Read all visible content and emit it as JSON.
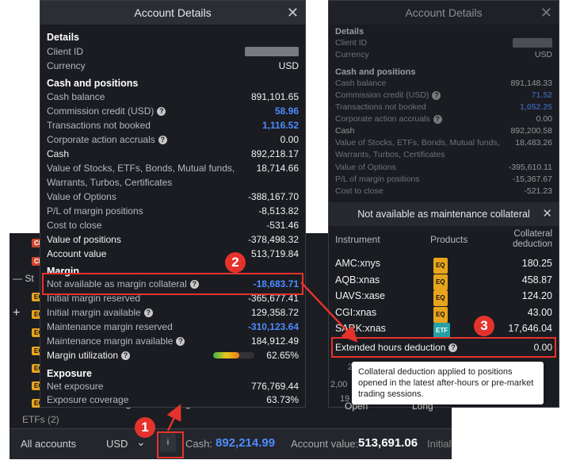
{
  "background": {
    "tickers": [
      "CF",
      "CF",
      "St",
      "EQ",
      "EQ",
      "EQ",
      "EQ",
      "EQ",
      "EQ",
      "EQ"
    ],
    "etfs_label": "ETFs (2)",
    "partial_text": "egation holdings incl",
    "bottom": {
      "accounts": "All accounts",
      "currency": "USD",
      "info_btn": "i",
      "cash_label": "Cash:",
      "cash_value": "892,214.99",
      "account_value_label": "Account value:",
      "account_value": "513,691.06",
      "initial": "Initial"
    }
  },
  "left_panel": {
    "title": "Account Details",
    "details": {
      "header": "Details",
      "client_id": "Client ID",
      "currency_label": "Currency",
      "currency_value": "USD"
    },
    "cash_positions": {
      "header": "Cash and positions",
      "cash_balance": [
        "Cash balance",
        "891,101.65"
      ],
      "commission_credit": [
        "Commission credit (USD)",
        "58.96"
      ],
      "transactions_not_booked": [
        "Transactions not booked",
        "1,116.52"
      ],
      "corporate_action": [
        "Corporate action accruals",
        "0.00"
      ],
      "cash": [
        "Cash",
        "892,218.17"
      ],
      "value_stocks_1": "Value of Stocks, ETFs, Bonds, Mutual funds,",
      "value_stocks_2": "Warrants, Turbos, Certificates",
      "value_stocks_v": "18,714.66",
      "value_options": [
        "Value of Options",
        "-388,167.70"
      ],
      "pl_margin": [
        "P/L of margin positions",
        "-8,513.82"
      ],
      "cost_close": [
        "Cost to close",
        "-531.46"
      ],
      "value_positions": [
        "Value of positions",
        "-378,498.32"
      ],
      "account_value": [
        "Account value",
        "513,719.84"
      ]
    },
    "margin": {
      "header": "Margin",
      "not_available": [
        "Not available as margin collateral",
        "-18,683.71"
      ],
      "initial_reserved": [
        "Initial margin reserved",
        "-365,677.41"
      ],
      "initial_available": [
        "Initial margin available",
        "129,358.72"
      ],
      "maint_reserved": [
        "Maintenance margin reserved",
        "-310,123.64"
      ],
      "maint_available": [
        "Maintenance margin available",
        "184,912.49"
      ],
      "utilization": [
        "Margin utilization",
        "62.65%"
      ],
      "utilization_fraction": 0.6265
    },
    "exposure": {
      "header": "Exposure",
      "net": [
        "Net exposure",
        "776,769.44"
      ],
      "coverage": [
        "Exposure coverage",
        "63.73%"
      ]
    }
  },
  "right_panel": {
    "title": "Account Details",
    "details": {
      "header": "Details",
      "client_id": "Client ID",
      "currency_label": "Currency",
      "currency_value": "USD"
    },
    "cash_positions": {
      "header": "Cash and positions",
      "cash_balance": [
        "Cash balance",
        "891,148.33"
      ],
      "commission_credit": [
        "Commission credit (USD)",
        "71.52"
      ],
      "transactions_not_booked": [
        "Transactions not booked",
        "1,052.25"
      ],
      "corporate_action": [
        "Corporate action accruals",
        "0.00"
      ],
      "cash": [
        "Cash",
        "892,200.58"
      ],
      "value_stocks_1": "Value of Stocks, ETFs, Bonds, Mutual funds,",
      "value_stocks_2": "Warrants, Turbos, Certificates",
      "value_stocks_v": "18,483.26",
      "value_options": [
        "Value of Options",
        "-395,610.11"
      ],
      "pl_margin": [
        "P/L of margin positions",
        "-15,367.67"
      ],
      "cost_close": [
        "Cost to close",
        "-521.23"
      ]
    },
    "subpanel": {
      "title": "Not available as maintenance collateral",
      "col_instrument": "Instrument",
      "col_products": "Products",
      "col_deduction_1": "Collateral",
      "col_deduction_2": "deduction",
      "rows": [
        {
          "instrument": "AMC:xnys",
          "product": "EQ",
          "value": "180.25"
        },
        {
          "instrument": "AQB:xnas",
          "product": "EQ",
          "value": "458.87"
        },
        {
          "instrument": "UAVS:xase",
          "product": "EQ",
          "value": "124.20"
        },
        {
          "instrument": "CGI:xnas",
          "product": "EQ",
          "value": "43.00"
        },
        {
          "instrument": "SARK:xnas",
          "product": "ETF",
          "value": "17,646.04"
        }
      ],
      "extended": [
        "Extended hours deduction",
        "0.00"
      ],
      "tooltip": "Collateral deduction applied to positions opened in the latest after-hours or pre-market trading sessions.",
      "under_1": "2",
      "under_2": "2,00",
      "under_3": "19",
      "under_4": "Open",
      "under_5": "Long"
    }
  },
  "callouts": [
    "1",
    "2",
    "3"
  ],
  "colors": {
    "accent_blue": "#4d8bff",
    "highlight_red": "#e5322d",
    "badge_eq": "#e8a51c",
    "badge_etf": "#25a0a5"
  }
}
